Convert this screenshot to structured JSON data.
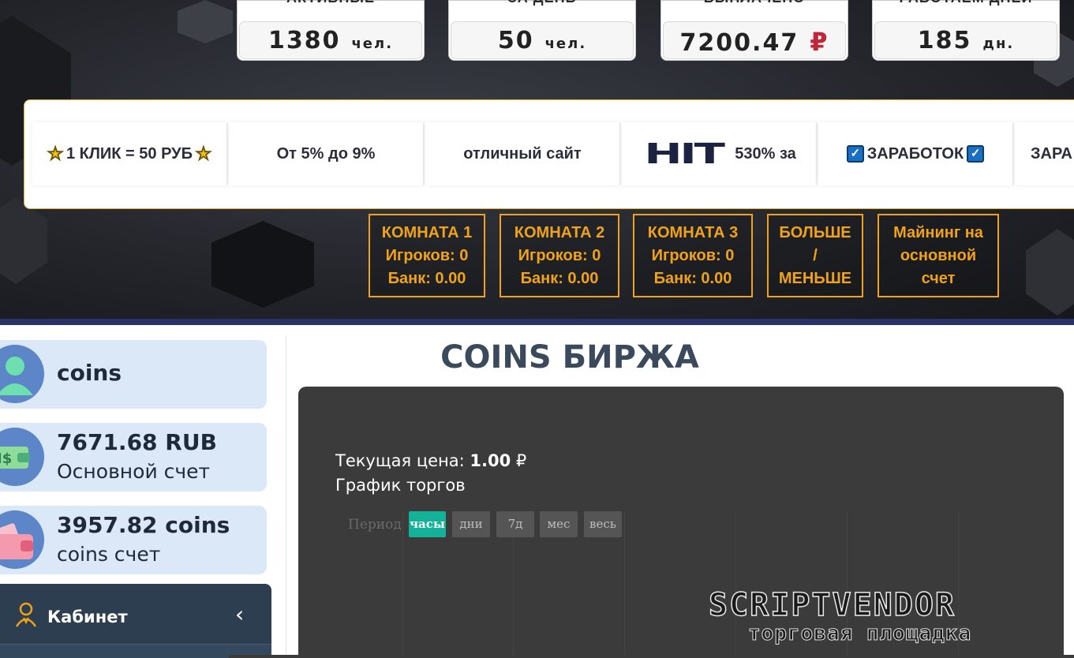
{
  "stats": [
    {
      "label": "АКТИВНЫЕ",
      "value": "1380",
      "unit": "чел."
    },
    {
      "label": "ЗА ДЕНЬ",
      "value": "50",
      "unit": "чел."
    },
    {
      "label": "ВЫПЛАЧЕНО",
      "value": "7200.47",
      "unit": "₽"
    },
    {
      "label": "РАБОТАЕМ ДНЕЙ",
      "value": "185",
      "unit": "дн."
    }
  ],
  "ticker": {
    "items": [
      {
        "text": "1 КЛИК = 50 РУБ"
      },
      {
        "text": "От 5% до 9%"
      },
      {
        "text": "отличный сайт"
      },
      {
        "badge": "HIT",
        "text": "530% за"
      },
      {
        "text": "ЗАРАБОТОК"
      },
      {
        "text": "ЗАРА"
      }
    ]
  },
  "rooms": [
    {
      "lines": [
        "КОМНАТА 1",
        "Игроков: 0",
        "Банк: 0.00"
      ]
    },
    {
      "lines": [
        "КОМНАТА 2",
        "Игроков: 0",
        "Банк: 0.00"
      ]
    },
    {
      "lines": [
        "КОМНАТА 3",
        "Игроков: 0",
        "Банк: 0.00"
      ]
    },
    {
      "lines": [
        "БОЛЬШЕ",
        "/",
        "МЕНЬШЕ"
      ]
    },
    {
      "lines": [
        "Майнинг на",
        "основной",
        "счет"
      ]
    }
  ],
  "sidebar": {
    "user": {
      "name": "coins",
      "icon": "user-avatar-icon"
    },
    "main_balance": {
      "amount": "7671.68 RUB",
      "label": "Основной счет",
      "icon": "money-wallet-icon"
    },
    "coins_balance": {
      "amount": "3957.82 coins",
      "label": "coins счет",
      "icon": "wallet-icon"
    },
    "menu": {
      "label": "Кабинет",
      "icon": "user-cabinet-icon"
    }
  },
  "main": {
    "title": "COINS БИРЖА",
    "price_label": "Текущая цена:",
    "price_value": "1.00",
    "price_currency": "₽",
    "chart_title": "График торгов",
    "period_label": "Период",
    "periods": [
      "часы",
      "дни",
      "7д",
      "мес",
      "весь"
    ],
    "active_period": "часы"
  },
  "watermark": {
    "brand": "SCRIPTVENDOR",
    "tagline": "торговая площадка"
  },
  "colors": {
    "accent": "#f0a21a",
    "active": "#15b29a",
    "sidebar_card": "#dbe8f8",
    "panel": "#3b3b3b",
    "rub": "#c1273a"
  }
}
